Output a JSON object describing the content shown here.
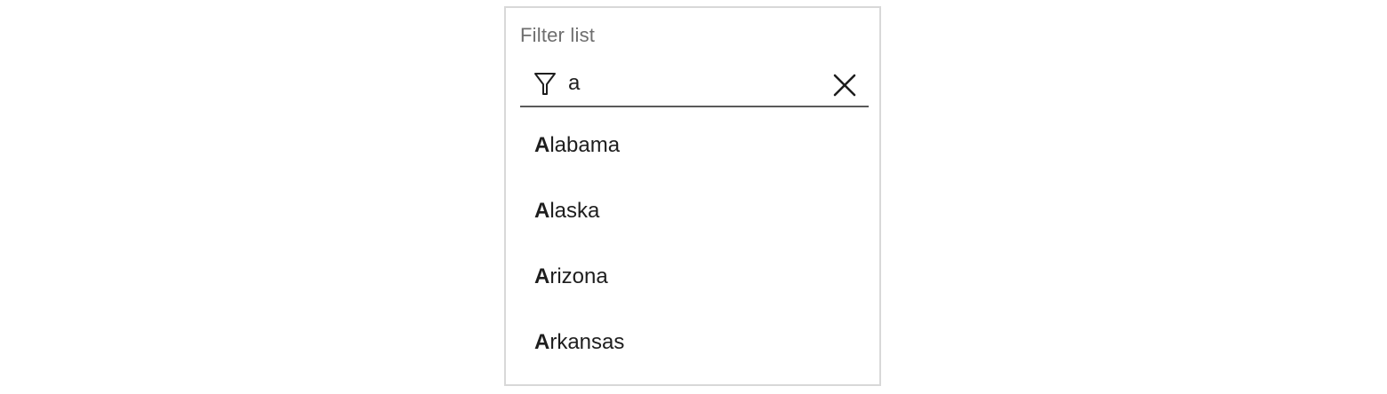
{
  "filter": {
    "label": "Filter list",
    "query": "a",
    "filter_icon": "funnel-icon",
    "clear_icon": "close-icon"
  },
  "items": [
    {
      "match": "A",
      "rest": "labama"
    },
    {
      "match": "A",
      "rest": "laska"
    },
    {
      "match": "A",
      "rest": "rizona"
    },
    {
      "match": "A",
      "rest": "rkansas"
    }
  ],
  "colors": {
    "label": "#6e6e6e",
    "text": "#1e1e1e",
    "border": "#d8d8d8",
    "underline": "#5a5a5a"
  }
}
